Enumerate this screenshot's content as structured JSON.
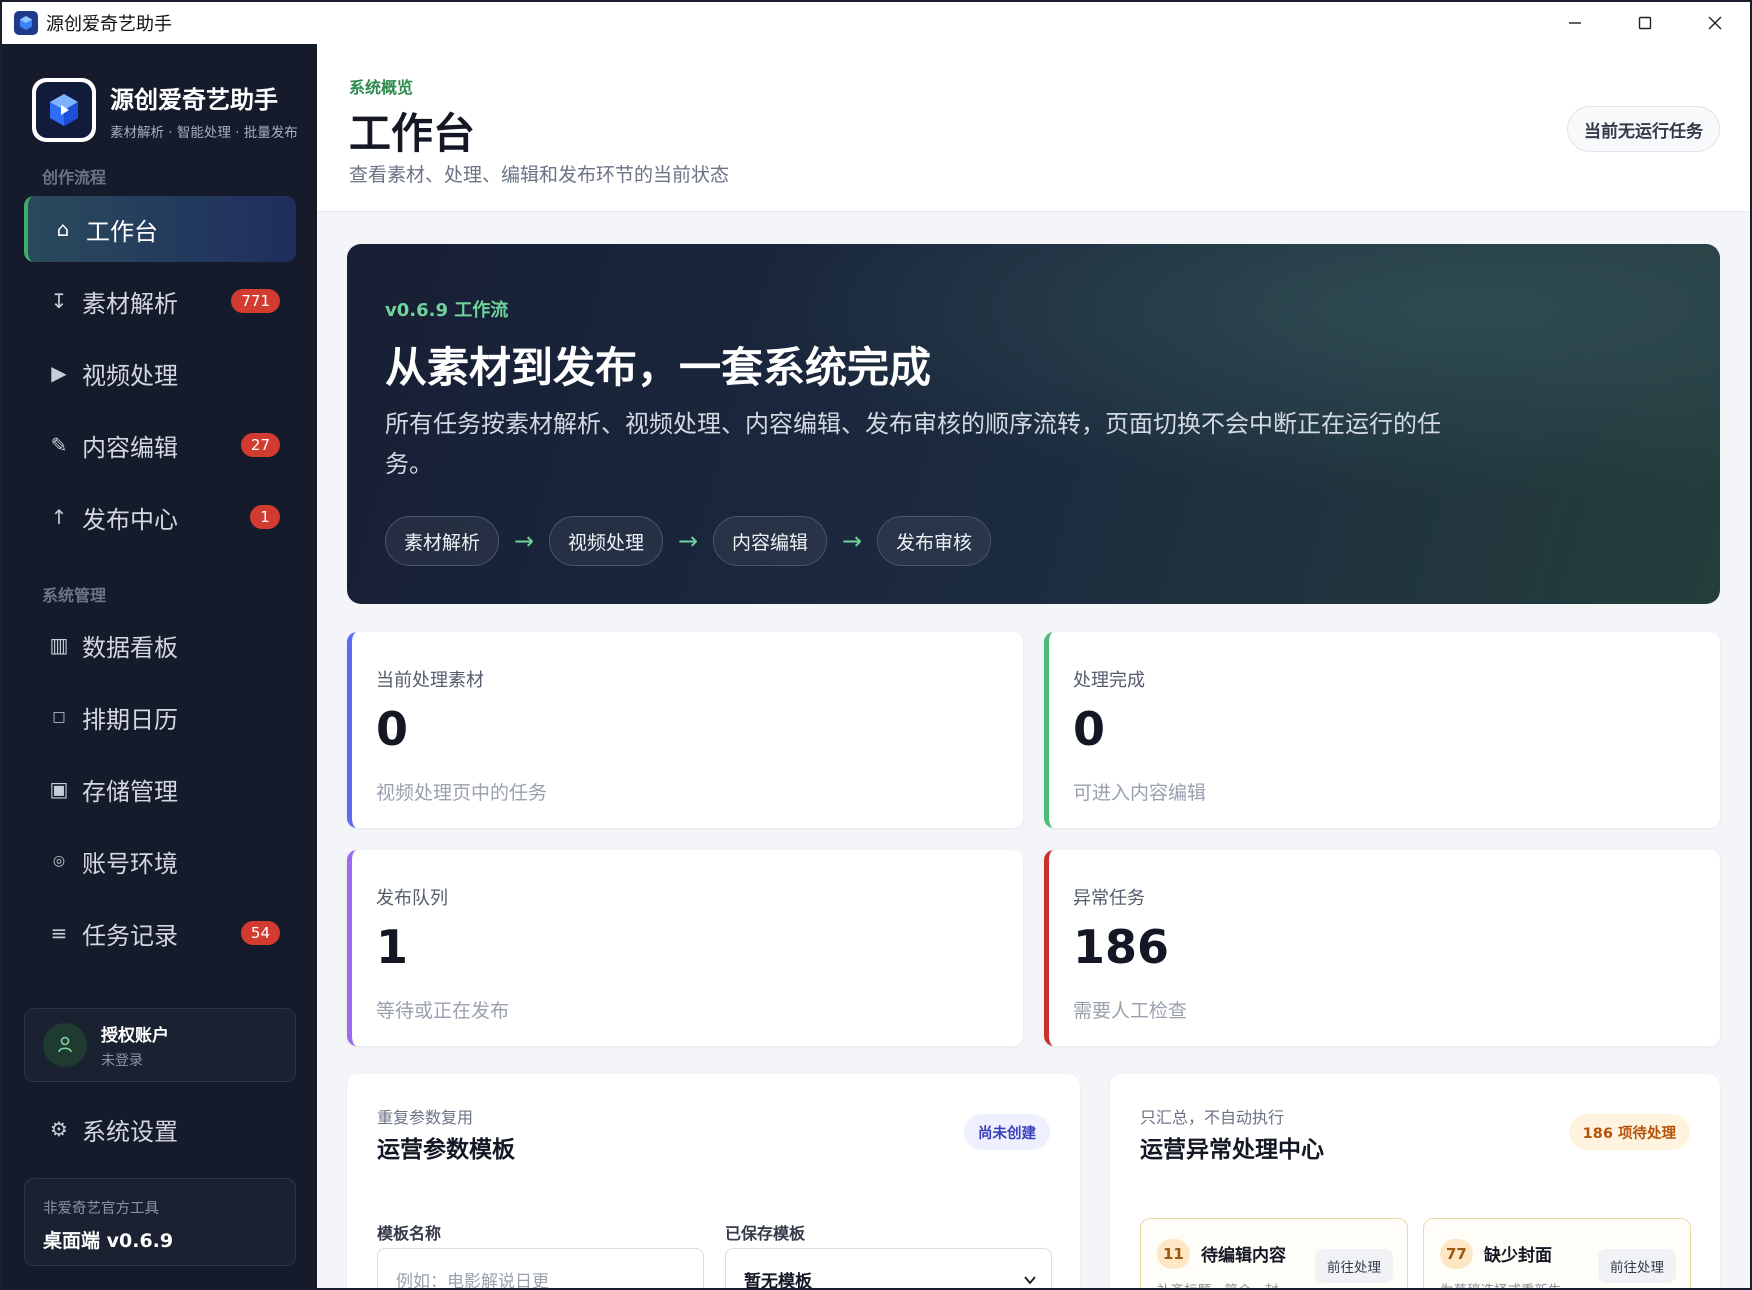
{
  "window": {
    "title": "源创爱奇艺助手"
  },
  "brand": {
    "name": "源创爱奇艺助手",
    "tagline": "素材解析 · 智能处理 · 批量发布"
  },
  "sidebar": {
    "section1": "创作流程",
    "section2": "系统管理",
    "items": [
      {
        "label": "工作台",
        "icon": "home-icon"
      },
      {
        "label": "素材解析",
        "icon": "download-arrow-icon",
        "badge": "771"
      },
      {
        "label": "视频处理",
        "icon": "play-icon"
      },
      {
        "label": "内容编辑",
        "icon": "pencil-icon",
        "badge": "27"
      },
      {
        "label": "发布中心",
        "icon": "upload-arrow-icon",
        "badge": "1"
      },
      {
        "label": "数据看板",
        "icon": "bars-icon"
      },
      {
        "label": "排期日历",
        "icon": "calendar-square-icon"
      },
      {
        "label": "存储管理",
        "icon": "storage-box-icon"
      },
      {
        "label": "账号环境",
        "icon": "target-icon"
      },
      {
        "label": "任务记录",
        "icon": "list-icon",
        "badge": "54"
      }
    ],
    "account": {
      "title": "授权账户",
      "status": "未登录"
    },
    "settings": "系统设置",
    "version": {
      "note": "非爱奇艺官方工具",
      "label": "桌面端 v0.6.9"
    }
  },
  "header": {
    "crumb": "系统概览",
    "title": "工作台",
    "desc": "查看素材、处理、编辑和发布环节的当前状态",
    "status": "当前无运行任务"
  },
  "hero": {
    "version": "v0.6.9 工作流",
    "title": "从素材到发布，一套系统完成",
    "desc": "所有任务按素材解析、视频处理、内容编辑、发布审核的顺序流转，页面切换不会中断正在运行的任务。",
    "steps": [
      "素材解析",
      "视频处理",
      "内容编辑",
      "发布审核"
    ],
    "arrow": "→"
  },
  "stats": [
    {
      "label": "当前处理素材",
      "value": "0",
      "sub": "视频处理页中的任务",
      "color": "#5b6cf0"
    },
    {
      "label": "处理完成",
      "value": "0",
      "sub": "可进入内容编辑",
      "color": "#4cbb7a"
    },
    {
      "label": "发布队列",
      "value": "1",
      "sub": "等待或正在发布",
      "color": "#9b6cf0"
    },
    {
      "label": "异常任务",
      "value": "186",
      "sub": "需要人工检查",
      "color": "#c8322a"
    }
  ],
  "template_panel": {
    "kicker": "重复参数复用",
    "title": "运营参数模板",
    "badge": "尚未创建",
    "name_label": "模板名称",
    "name_placeholder": "例如：电影解说日更",
    "saved_label": "已保存模板",
    "saved_value": "暂无模板"
  },
  "exception_panel": {
    "kicker": "只汇总，不自动执行",
    "title": "运营异常处理中心",
    "badge": "186 项待处理",
    "cards": [
      {
        "count": "11",
        "title": "待编辑内容",
        "desc": "补齐标题、简介、封...",
        "action": "前往处理"
      },
      {
        "count": "77",
        "title": "缺少封面",
        "desc": "为草稿选择或重新生...",
        "action": "前往处理"
      }
    ]
  },
  "colors": {
    "accent": "#3fae6a",
    "sidebar": "#151b2a",
    "badge": "#d23b2f"
  }
}
